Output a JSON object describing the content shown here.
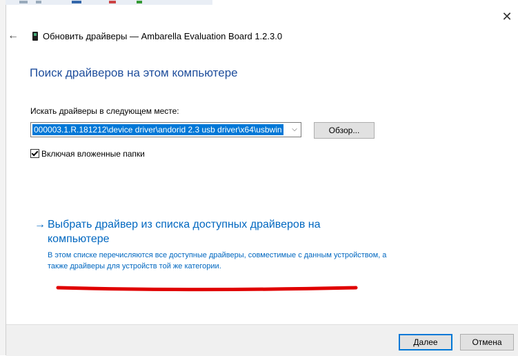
{
  "window": {
    "title": "Обновить драйверы — Ambarella Evaluation Board 1.2.3.0",
    "close_symbol": "✕",
    "back_symbol": "←"
  },
  "main": {
    "heading": "Поиск драйверов на этом компьютере",
    "search_label": "Искать драйверы в следующем месте:",
    "path_value": "000003.1.R.181212\\device driver\\andorid 2.3 usb driver\\x64\\usbwin",
    "dropdown_symbol": "⌵",
    "browse_label": "Обзор...",
    "include_subfolders_label": "Включая вложенные папки",
    "include_subfolders_checked": true,
    "pick_link_arrow": "→",
    "pick_link_label": "Выбрать драйвер из списка доступных драйверов на компьютере",
    "pick_description": "В этом списке перечисляются все доступные драйверы, совместимые с данным устройством, а также драйверы для устройств той же категории."
  },
  "footer": {
    "next_label": "Далее",
    "cancel_label": "Отмена"
  },
  "colors": {
    "heading": "#1f4e9c",
    "link": "#0067c0",
    "selection": "#0078d7",
    "annotation": "#e00000"
  },
  "icons": {
    "device": "device-icon",
    "back": "back-arrow-icon",
    "close": "close-icon",
    "checkbox": "checkmark-icon"
  }
}
